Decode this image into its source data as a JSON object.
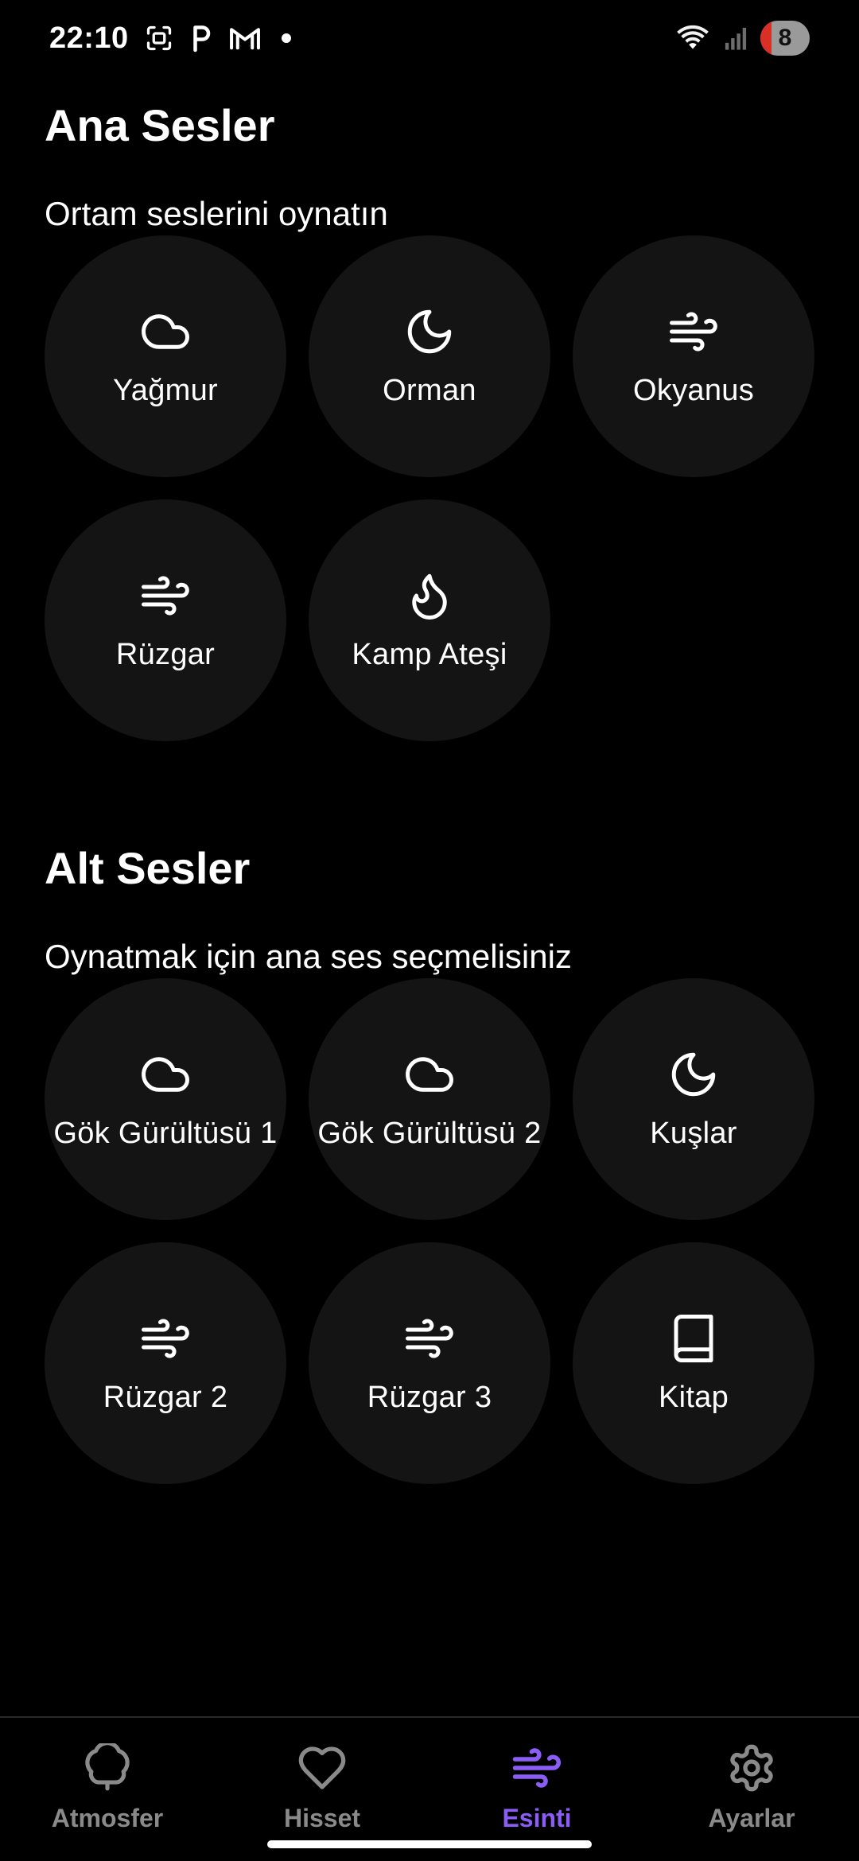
{
  "status_bar": {
    "time": "22:10",
    "battery": "8",
    "notification_icons": [
      "screenshot-icon",
      "parking-p-icon",
      "gmail-icon",
      "dot-icon"
    ],
    "system_icons": [
      "wifi-icon",
      "signal-icon",
      "battery-icon"
    ]
  },
  "main_sounds": {
    "title": "Ana Sesler",
    "subtitle": "Ortam seslerini oynatın",
    "items": [
      {
        "label": "Yağmur",
        "icon": "cloud-icon"
      },
      {
        "label": "Orman",
        "icon": "moon-icon"
      },
      {
        "label": "Okyanus",
        "icon": "wind-icon"
      },
      {
        "label": "Rüzgar",
        "icon": "wind-icon"
      },
      {
        "label": "Kamp Ateşi",
        "icon": "flame-icon"
      }
    ]
  },
  "sub_sounds": {
    "title": "Alt Sesler",
    "subtitle": "Oynatmak için ana ses seçmelisiniz",
    "items": [
      {
        "label": "Gök Gürültüsü 1",
        "icon": "cloud-icon"
      },
      {
        "label": "Gök Gürültüsü 2",
        "icon": "cloud-icon"
      },
      {
        "label": "Kuşlar",
        "icon": "moon-icon"
      },
      {
        "label": "Rüzgar 2",
        "icon": "wind-icon"
      },
      {
        "label": "Rüzgar 3",
        "icon": "wind-icon"
      },
      {
        "label": "Kitap",
        "icon": "book-icon"
      }
    ]
  },
  "bottom_nav": {
    "items": [
      {
        "label": "Atmosfer",
        "icon": "tree-icon",
        "active": false
      },
      {
        "label": "Hisset",
        "icon": "heart-icon",
        "active": false
      },
      {
        "label": "Esinti",
        "icon": "wind-icon",
        "active": true
      },
      {
        "label": "Ayarlar",
        "icon": "gear-icon",
        "active": false
      }
    ]
  },
  "colors": {
    "background": "#000000",
    "button_bg": "#141414",
    "accent": "#8b5cf6",
    "inactive_nav": "#8a8a8a"
  }
}
